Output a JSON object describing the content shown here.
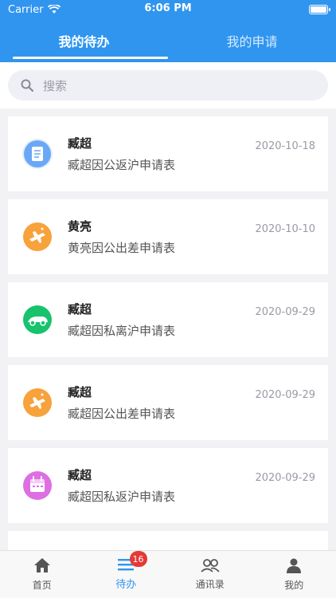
{
  "statusbar": {
    "carrier": "Carrier",
    "time": "6:06 PM"
  },
  "tabs": [
    {
      "label": "我的待办",
      "active": true
    },
    {
      "label": "我的申请",
      "active": false
    }
  ],
  "search": {
    "placeholder": "搜索"
  },
  "items": [
    {
      "name": "臧超",
      "desc": "臧超因公返沪申请表",
      "date": "2020-10-18",
      "icon": "document-icon",
      "color": "#6aa8f5"
    },
    {
      "name": "黄亮",
      "desc": "黄亮因公出差申请表",
      "date": "2020-10-10",
      "icon": "airplane-icon",
      "color": "#f7a23b"
    },
    {
      "name": "臧超",
      "desc": "臧超因私离沪申请表",
      "date": "2020-09-29",
      "icon": "car-icon",
      "color": "#18c36d"
    },
    {
      "name": "臧超",
      "desc": "臧超因公出差申请表",
      "date": "2020-09-29",
      "icon": "airplane-icon",
      "color": "#f7a23b"
    },
    {
      "name": "臧超",
      "desc": "臧超因私返沪申请表",
      "date": "2020-09-29",
      "icon": "calendar-icon",
      "color": "#dd6fe3"
    }
  ],
  "tabbar": {
    "items": [
      {
        "label": "首页",
        "icon": "home-icon"
      },
      {
        "label": "待办",
        "icon": "list-icon",
        "badge": "16",
        "active": true
      },
      {
        "label": "通讯录",
        "icon": "contacts-icon"
      },
      {
        "label": "我的",
        "icon": "person-icon"
      }
    ]
  },
  "colors": {
    "primary": "#2f95ef",
    "badge": "#e53935"
  }
}
